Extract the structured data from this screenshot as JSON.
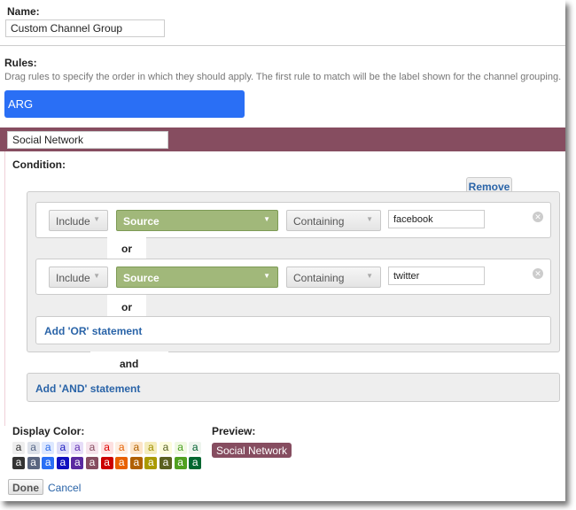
{
  "name": {
    "label": "Name:",
    "value": "Custom Channel Group"
  },
  "rules": {
    "label": "Rules:",
    "description": "Drag rules to specify the order in which they should apply. The first rule to match will be the label shown for the channel grouping.",
    "items": [
      {
        "label": "ARG",
        "color": "#2a6ff5"
      }
    ]
  },
  "rule": {
    "name": "Social Network",
    "color": "#864d60",
    "condition_label": "Condition:",
    "remove_label": "Remove",
    "conditions": [
      {
        "include": "Include",
        "dimension": "Source",
        "match": "Containing",
        "value": "facebook"
      },
      {
        "include": "Include",
        "dimension": "Source",
        "match": "Containing",
        "value": "twitter"
      }
    ],
    "or_label": "or",
    "and_label": "and",
    "add_or": "Add 'OR' statement",
    "add_and": "Add 'AND' statement"
  },
  "display_color": {
    "label": "Display Color:",
    "swatch_text": "a",
    "light": [
      [
        "#eeeeee",
        "#333333"
      ],
      [
        "#dde2ea",
        "#5a6a8a"
      ],
      [
        "#dde8ff",
        "#2a6ae8"
      ],
      [
        "#dcdcf8",
        "#2020c0"
      ],
      [
        "#e6ddf8",
        "#6030b0"
      ],
      [
        "#f6e4ec",
        "#864d60"
      ],
      [
        "#fde0e0",
        "#dd0000"
      ],
      [
        "#fdeee2",
        "#e66000"
      ],
      [
        "#fce4c8",
        "#b06000"
      ],
      [
        "#f4ecbc",
        "#a09000"
      ],
      [
        "#fcfcdc",
        "#556020"
      ],
      [
        "#f0f8e2",
        "#48a020"
      ],
      [
        "#eef4ee",
        "#006030"
      ]
    ],
    "dark": [
      [
        "#333333",
        "#ffffff"
      ],
      [
        "#5a6680",
        "#ffffff"
      ],
      [
        "#2a6ff5",
        "#ffffff"
      ],
      [
        "#1010c0",
        "#ffffff"
      ],
      [
        "#5a2aa0",
        "#ffffff"
      ],
      [
        "#864d60",
        "#ffffff"
      ],
      [
        "#cc0000",
        "#ffffff"
      ],
      [
        "#e86000",
        "#ffffff"
      ],
      [
        "#b06000",
        "#ffffff"
      ],
      [
        "#aa9a00",
        "#ffffff"
      ],
      [
        "#5a6020",
        "#ffffff"
      ],
      [
        "#50a020",
        "#ffffff"
      ],
      [
        "#006630",
        "#ffffff"
      ]
    ]
  },
  "preview": {
    "label": "Preview:",
    "text": "Social Network"
  },
  "actions": {
    "done": "Done",
    "cancel": "Cancel"
  }
}
